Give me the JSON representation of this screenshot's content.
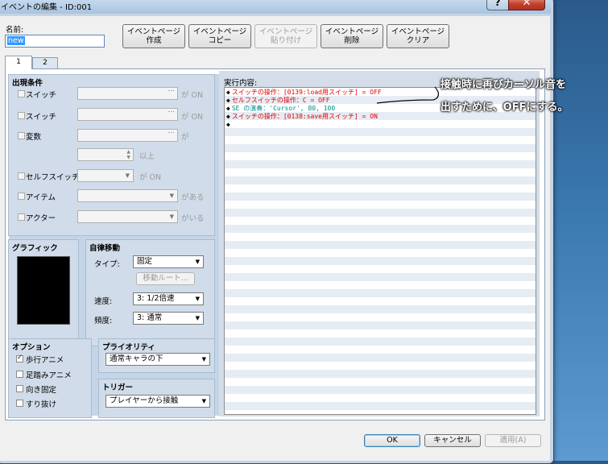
{
  "window": {
    "title": "イベントの編集 - ID:001",
    "help": "?",
    "close": "✕"
  },
  "name": {
    "label": "名前:",
    "value": "new"
  },
  "toolbar": [
    {
      "line1": "イベントページ",
      "line2": "作成",
      "enabled": true
    },
    {
      "line1": "イベントページ",
      "line2": "コピー",
      "enabled": true
    },
    {
      "line1": "イベントページ",
      "line2": "貼り付け",
      "enabled": false
    },
    {
      "line1": "イベントページ",
      "line2": "削除",
      "enabled": true
    },
    {
      "line1": "イベントページ",
      "line2": "クリア",
      "enabled": true
    }
  ],
  "tabs": [
    "1",
    "2"
  ],
  "conditions": {
    "title": "出現条件",
    "switch1": {
      "label": "スイッチ",
      "suffix": "が ON"
    },
    "switch2": {
      "label": "スイッチ",
      "suffix": "が ON"
    },
    "variable": {
      "label": "変数",
      "suffix": "が",
      "suffix2": "以上"
    },
    "self_switch": {
      "label": "セルフスイッチ",
      "suffix": "が ON"
    },
    "item": {
      "label": "アイテム",
      "suffix": "がある"
    },
    "actor": {
      "label": "アクター",
      "suffix": "がいる"
    }
  },
  "graphic": {
    "title": "グラフィック"
  },
  "autonomous": {
    "title": "自律移動",
    "type_label": "タイプ:",
    "type_value": "固定",
    "route_button": "移動ルート...",
    "speed_label": "速度:",
    "speed_value": "3: 1/2倍速",
    "freq_label": "頻度:",
    "freq_value": "3: 通常"
  },
  "options": {
    "title": "オプション",
    "walking": "歩行アニメ",
    "walking_checked": true,
    "stepping": "足踏みアニメ",
    "stepping_checked": false,
    "direction_fix": "向き固定",
    "direction_fix_checked": false,
    "through": "すり抜け",
    "through_checked": false
  },
  "priority": {
    "title": "プライオリティ",
    "value": "通常キャラの下"
  },
  "trigger": {
    "title": "トリガー",
    "value": "プレイヤーから接触"
  },
  "commands": {
    "label": "実行内容:",
    "items": [
      {
        "text": "スイッチの操作：[0139:load用スイッチ] = OFF",
        "color": "#e00000"
      },
      {
        "text": "セルフスイッチの操作：C = OFF",
        "color": "#e00000"
      },
      {
        "text": "SE の演奏：'Cursor', 80, 100",
        "color": "#008b8b"
      },
      {
        "text": "スイッチの操作：[0138:save用スイッチ] = ON",
        "color": "#e00000"
      },
      {
        "text": "",
        "color": "#000000"
      }
    ]
  },
  "footer": {
    "ok": "OK",
    "cancel": "キャンセル",
    "apply": "適用(A)"
  },
  "annotation": {
    "line1": "接触時に再びカーソル音を",
    "line2": "出すために、OFFにする。"
  }
}
